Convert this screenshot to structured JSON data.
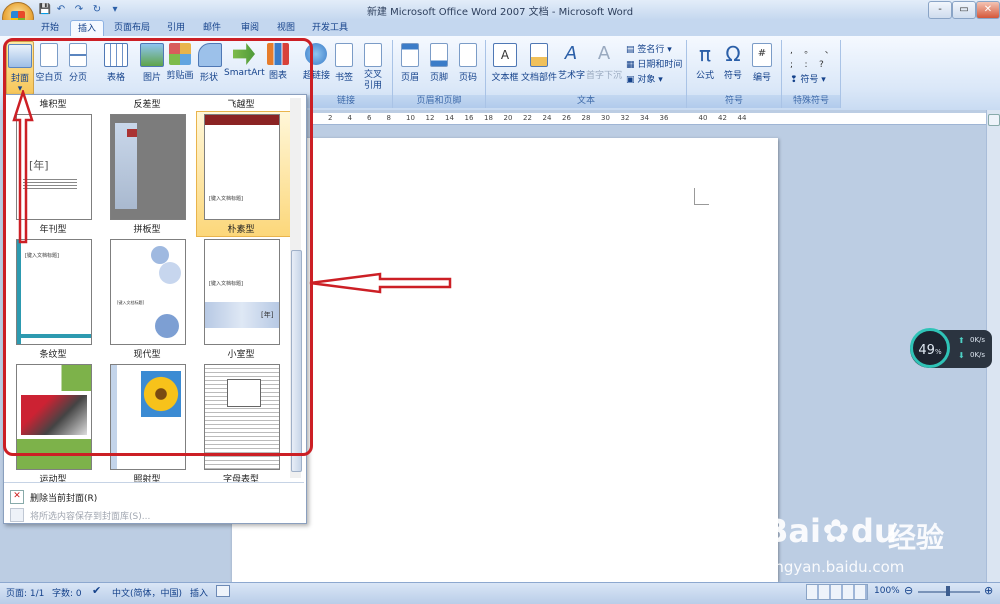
{
  "window": {
    "title": "新建 Microsoft Office Word 2007 文档 - Microsoft Word",
    "controls": [
      "-",
      "▭",
      "✕"
    ]
  },
  "tabs": [
    "开始",
    "插入",
    "页面布局",
    "引用",
    "邮件",
    "审阅",
    "视图",
    "开发工具"
  ],
  "active_tab": "插入",
  "ribbon": {
    "pages_group": {
      "buttons": [
        "封面",
        "空白页",
        "分页"
      ]
    },
    "illustrations": {
      "buttons": [
        "表格",
        "图片",
        "剪贴画",
        "形状",
        "SmartArt",
        "图表"
      ]
    },
    "links": {
      "buttons": [
        "超链接",
        "书签",
        "交叉引用"
      ],
      "label": "链接"
    },
    "header_footer": {
      "buttons": [
        "页眉",
        "页脚",
        "页码"
      ],
      "label": "页眉和页脚"
    },
    "text": {
      "buttons": [
        "文本框",
        "文档部件",
        "艺术字",
        "首字下沉"
      ],
      "small": [
        "签名行",
        "日期和时间",
        "对象"
      ],
      "label": "文本"
    },
    "symbols": {
      "buttons": [
        "公式",
        "符号",
        "编号"
      ],
      "label": "符号"
    },
    "special": {
      "label": "特殊符号",
      "small": "符号"
    }
  },
  "gallery": {
    "top_labels": [
      "堆积型",
      "反差型",
      "飞越型"
    ],
    "covers": [
      {
        "label": "年刊型"
      },
      {
        "label": "拼板型"
      },
      {
        "label": "朴素型"
      },
      {
        "label": "条纹型"
      },
      {
        "label": "现代型"
      },
      {
        "label": "小室型"
      },
      {
        "label": "运动型"
      },
      {
        "label": "照射型"
      },
      {
        "label": "字母表型"
      }
    ],
    "cover_texts": {
      "year": "[年]",
      "title_placeholder": "[键入文档标题]",
      "year_small": "[年]"
    },
    "footer": {
      "remove_label": "删除当前封面(R)",
      "save_label": "将所选内容保存到封面库(S)..."
    }
  },
  "ruler_numbers": [
    "2",
    "4",
    "6",
    "8",
    "10",
    "12",
    "14",
    "16",
    "18",
    "20",
    "22",
    "24",
    "26",
    "28",
    "30",
    "32",
    "34",
    "36",
    "",
    "40",
    "42",
    "44"
  ],
  "status": {
    "page": "页面: 1/1",
    "words": "字数: 0",
    "lang": "中文(简体，中国)",
    "mode": "插入",
    "zoom": "100%"
  },
  "net_widget": {
    "percent": "49",
    "percent_unit": "%",
    "up": "0K/s",
    "down": "0K/s"
  },
  "watermark": {
    "brand": "Bai",
    "brand2": "du",
    "text": "经验",
    "url": "jingyan.baidu.com"
  },
  "colors": {
    "annotation_red": "#cc1f25",
    "ribbon_text": "#15428b"
  }
}
